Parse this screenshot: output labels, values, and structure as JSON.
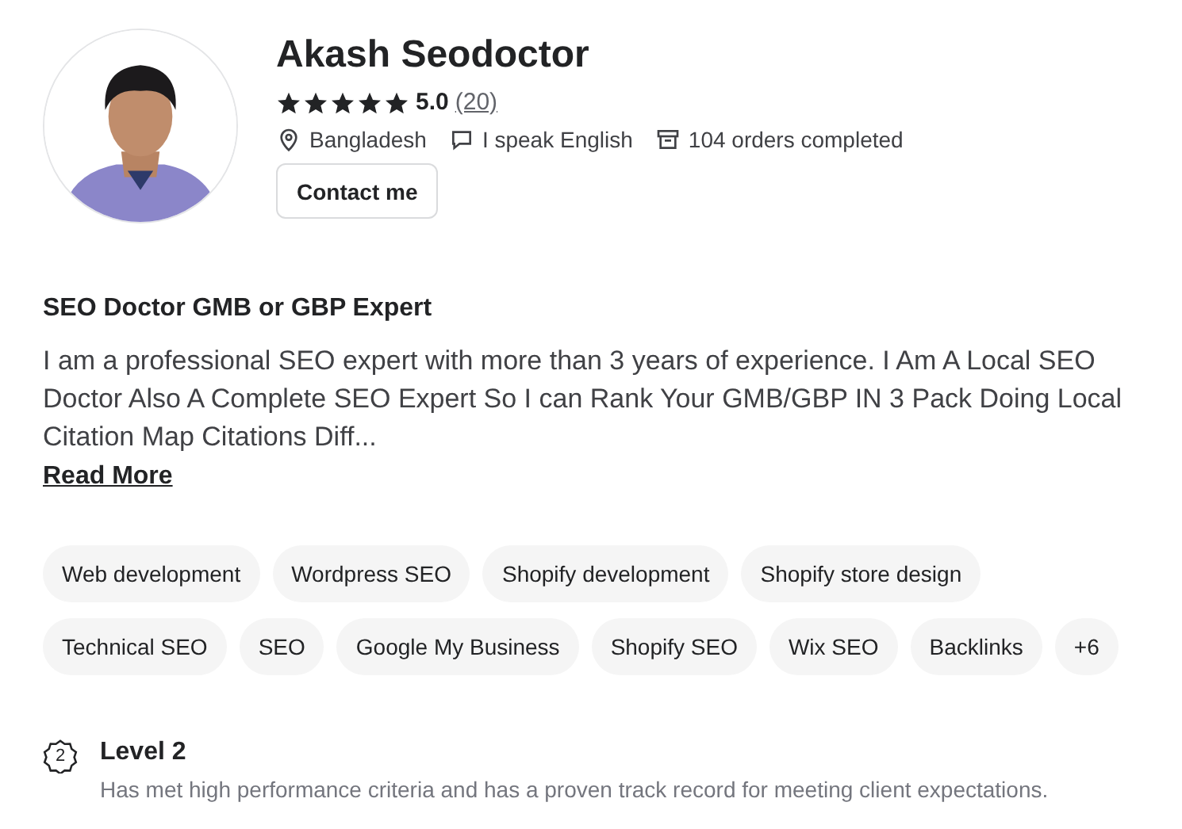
{
  "profile": {
    "name": "Akash Seodoctor",
    "stars": 5,
    "rating": "5.0",
    "reviews": "(20)",
    "meta": [
      {
        "kind": "location",
        "text": "Bangladesh"
      },
      {
        "kind": "language",
        "text": "I speak English"
      },
      {
        "kind": "orders",
        "text": "104 orders completed"
      }
    ],
    "contact_button": "Contact me"
  },
  "about": {
    "title": "SEO Doctor GMB or GBP Expert",
    "description": "I am a professional SEO expert with more than 3 years of experience. I Am A Local SEO Doctor Also A Complete SEO Expert So I can Rank Your GMB/GBP IN 3 Pack Doing Local Citation Map Citations Diff...",
    "read_more": "Read More"
  },
  "skills": [
    "Web development",
    "Wordpress SEO",
    "Shopify development",
    "Shopify store design",
    "Technical SEO",
    "SEO",
    "Google My Business",
    "Shopify SEO",
    "Wix SEO",
    "Backlinks",
    "+6"
  ],
  "level": {
    "badge": "2",
    "title": "Level 2",
    "description": "Has met high performance criteria and has a proven track record for meeting client expectations."
  }
}
